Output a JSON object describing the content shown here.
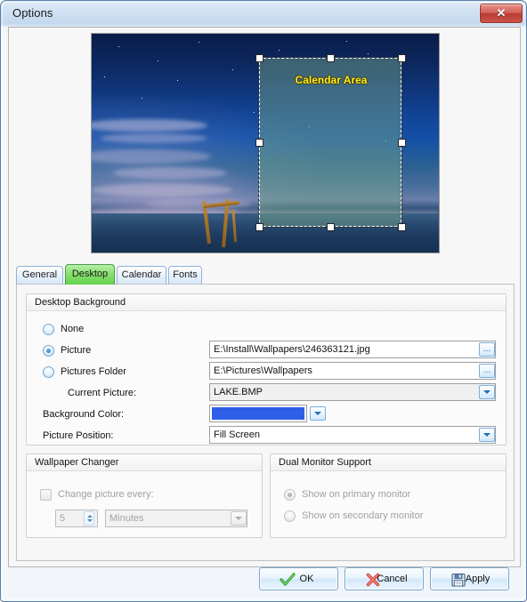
{
  "window": {
    "title": "Options",
    "close_glyph": "✕",
    "close_icon_name": "close-icon"
  },
  "preview": {
    "calendar_area_label": "Calendar Area",
    "label_color": "#ffee22",
    "selection_fill": "rgba(122,170,140,0.45)"
  },
  "tabs": [
    {
      "label": "General",
      "active": false
    },
    {
      "label": "Desktop",
      "active": true
    },
    {
      "label": "Calendar",
      "active": false
    },
    {
      "label": "Fonts",
      "active": false
    }
  ],
  "desktop_background": {
    "group_title": "Desktop Background",
    "options": [
      {
        "label": "None",
        "selected": false
      },
      {
        "label": "Picture",
        "selected": true
      },
      {
        "label": "Pictures Folder",
        "selected": false
      }
    ],
    "picture_path": "E:\\Install\\Wallpapers\\246363121.jpg",
    "pictures_folder_path": "E:\\Pictures\\Wallpapers",
    "current_picture_label": "Current Picture:",
    "current_picture_value": "LAKE.BMP",
    "background_color_label": "Background Color:",
    "background_color_value": "#2f5fe8",
    "picture_position_label": "Picture Position:",
    "picture_position_value": "Fill Screen",
    "browse_button_glyph": "...",
    "dropdown_icon_name": "chevron-down-icon"
  },
  "wallpaper_changer": {
    "group_title": "Wallpaper Changer",
    "checkbox_label": "Change picture every:",
    "checked": false,
    "interval_value": "5",
    "unit_value": "Minutes",
    "enabled": false
  },
  "dual_monitor": {
    "group_title": "Dual Monitor Support",
    "options": [
      {
        "label": "Show on primary monitor",
        "selected": true
      },
      {
        "label": "Show on secondary monitor",
        "selected": false
      }
    ],
    "enabled": false
  },
  "footer": {
    "ok_label": "OK",
    "cancel_label": "Cancel",
    "apply_label": "Apply",
    "ok_icon": "checkmark-icon",
    "cancel_icon": "cross-icon",
    "apply_icon": "save-disk-icon"
  }
}
